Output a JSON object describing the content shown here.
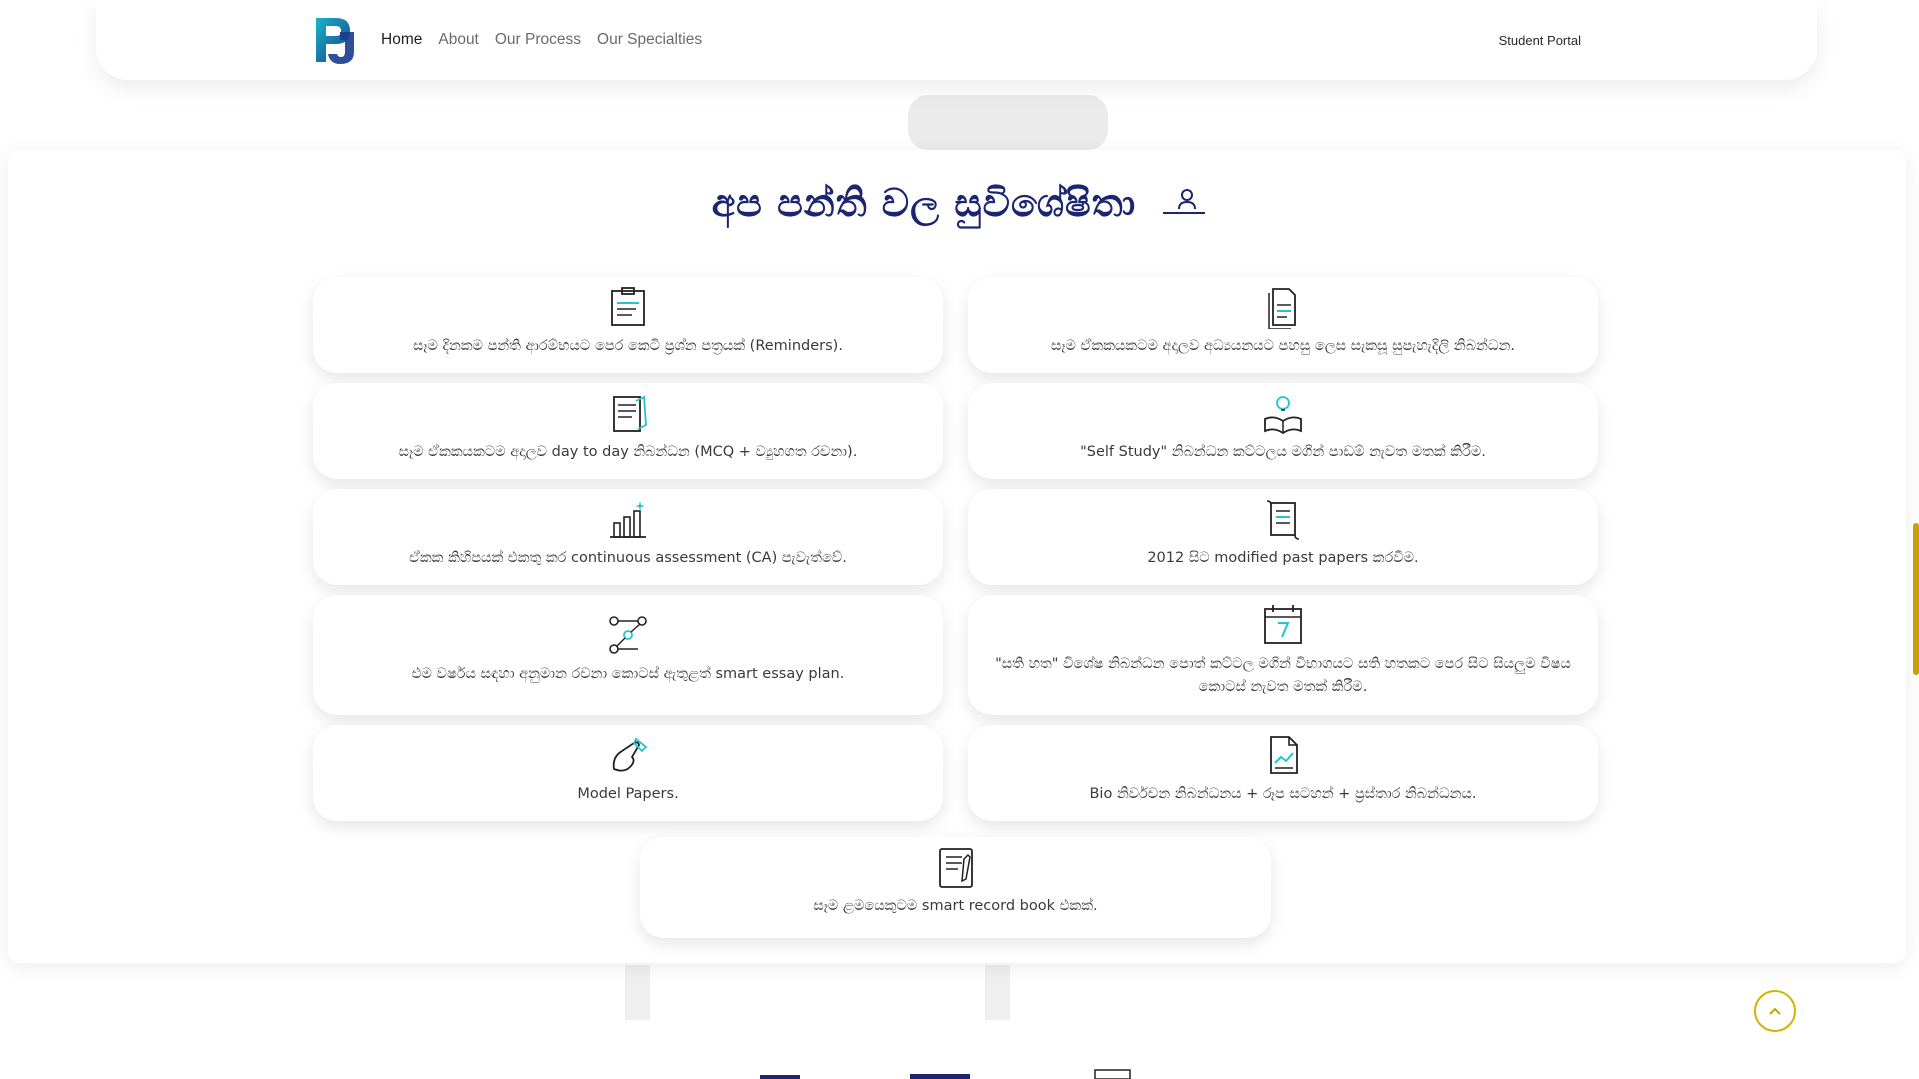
{
  "navbar": {
    "links": [
      "Home",
      "About",
      "Our Process",
      "Our Specialties"
    ],
    "portal": "Student Portal"
  },
  "section": {
    "title": "අප පන්ති වල සුවිශේෂිතා"
  },
  "cards": [
    {
      "text": "සෑම දිනකම පන්ති ආරම්භයට පෙර කෙටි ප්‍රශ්න පත්‍රයක් (Reminders).",
      "icon": "clipboard-icon"
    },
    {
      "text": "සෑම ඒකකයකටම අදාලව අධ්‍යයනයට පහසු ලෙස සැකසූ සුපැහැදිලි නිබන්ධන.",
      "icon": "document-icon"
    },
    {
      "text": "සෑම ඒකකයකටම අදාලව day to day නිබන්ධන (MCQ + ව්‍යුහගත රචනා).",
      "icon": "notes-icon"
    },
    {
      "text": "\"Self Study\" නිබන්ධන කට්ටලය මගින් පාඩම් නැවත මතක් කිරීම.",
      "icon": "book-bulb-icon"
    },
    {
      "text": "ඒකක කිහිපයක් එකතු කර continuous assessment (CA) පැවැත්වේ.",
      "icon": "chart-icon"
    },
    {
      "text": "2012 සිට modified past papers කරවීම.",
      "icon": "scroll-icon"
    },
    {
      "text": "එම වර්ෂය සඳහා අනුමාන රචනා කොටස් ඇතුළත් smart essay plan.",
      "icon": "flow-icon"
    },
    {
      "text": "\"සති හත\" විශේෂ නිබන්ධන පොත් කට්ටල මගින් විභාගයට සති හතකට පෙර සිට සියලුම විෂය කොටස් නැවත මතක් කිරීම.",
      "icon": "calendar-icon"
    },
    {
      "text": "Model Papers.",
      "icon": "pen-hand-icon"
    },
    {
      "text": "Bio නිර්වචන නිබන්ධනය + රූප සටහන් + ප්‍රස්තාර නිබන්ධනය.",
      "icon": "file-chart-icon"
    },
    {
      "text": "සෑම ළමයෙකුටම smart record book එකක්.",
      "icon": "record-book-icon"
    }
  ],
  "colors": {
    "title": "#1b2570",
    "accent": "#23c6c8",
    "scroll_button": "#d4b200"
  }
}
